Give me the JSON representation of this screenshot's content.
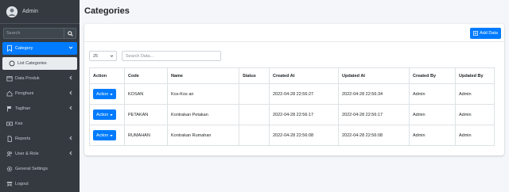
{
  "sidebar": {
    "user_name": "Admin",
    "search_placeholder": "Search",
    "items": [
      {
        "label": "Category",
        "icon": "bookmark-icon"
      },
      {
        "label": "List Categories",
        "icon": "circle-icon"
      },
      {
        "label": "Data Produk",
        "icon": "box-icon"
      },
      {
        "label": "Penghuni",
        "icon": "house-icon"
      },
      {
        "label": "Tagihan",
        "icon": "flag-icon"
      },
      {
        "label": "Kas",
        "icon": "money-icon"
      },
      {
        "label": "Reports",
        "icon": "file-icon"
      },
      {
        "label": "User & Role",
        "icon": "users-icon"
      },
      {
        "label": "General Settings",
        "icon": "gear-icon"
      },
      {
        "label": "Logout",
        "icon": "logout-icon"
      }
    ]
  },
  "main": {
    "title": "Categories",
    "add_label": "Add Data",
    "page_size": "25",
    "table_search_placeholder": "Search Data...",
    "columns": [
      "Action",
      "Code",
      "Name",
      "Status",
      "Created At",
      "Updated At",
      "Created By",
      "Updated By"
    ],
    "action_label": "Action",
    "rows": [
      [
        "KOSAN",
        "Kos-Kos an",
        "",
        "2022-04-28 22:56:27",
        "2022-04-28 22:56:34",
        "Admin",
        "Admin"
      ],
      [
        "PETAKAN",
        "Kontrakan Petakan",
        "",
        "2022-04-28 22:56:17",
        "2022-04-28 22:56:17",
        "Admin",
        "Admin"
      ],
      [
        "RUMAHAN",
        "Kontrakan Rumahan",
        "",
        "2022-04-28 22:56:08",
        "2022-04-28 22:56:08",
        "Admin",
        "Admin"
      ]
    ]
  },
  "colors": {
    "sidebar_bg": "#343a40",
    "primary": "#007bff",
    "page_bg": "#f4f6f9"
  }
}
